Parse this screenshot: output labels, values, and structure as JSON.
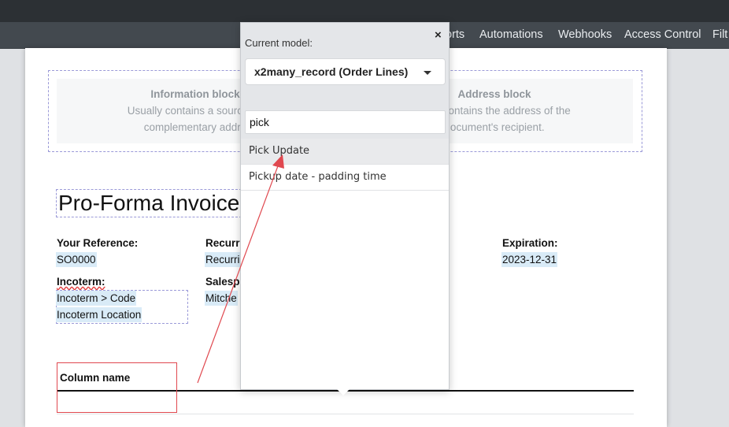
{
  "topbar": {},
  "menubar": {
    "items": [
      "orts",
      "Automations",
      "Webhooks",
      "Access Control",
      "Filt"
    ]
  },
  "document": {
    "info_block": {
      "title": "Information block",
      "line1": "Usually contains a source ad",
      "line2": "complementary addre"
    },
    "address_block": {
      "title": "Address block",
      "line1": "ually contains the address of the",
      "line2": "document's recipient."
    },
    "title": "Pro-Forma Invoice",
    "fields": {
      "your_reference_label": "Your Reference:",
      "your_reference_value": "SO0000",
      "recurring_label": "Recurri",
      "recurring_value": "Recurri",
      "expiration_label": "Expiration:",
      "expiration_value": "2023-12-31",
      "incoterm_label": "Incoterm:",
      "incoterm_code": "Incoterm > Code",
      "incoterm_location": "Incoterm Location",
      "salesperson_label": "Salespe",
      "salesperson_value": "Mitche"
    },
    "table": {
      "column_name": "Column name"
    }
  },
  "popover": {
    "title": "Current model:",
    "close": "×",
    "model": "x2many_record (Order Lines)",
    "search_value": "pick",
    "results": [
      "Pick Update",
      "Pickup date - padding time"
    ]
  },
  "colors": {
    "topbar": "#2c3034",
    "menubar": "#43494f",
    "highlight_red": "#e0484f",
    "dashed_border": "#9b9ad8",
    "field_highlight": "#d9ebf7"
  }
}
